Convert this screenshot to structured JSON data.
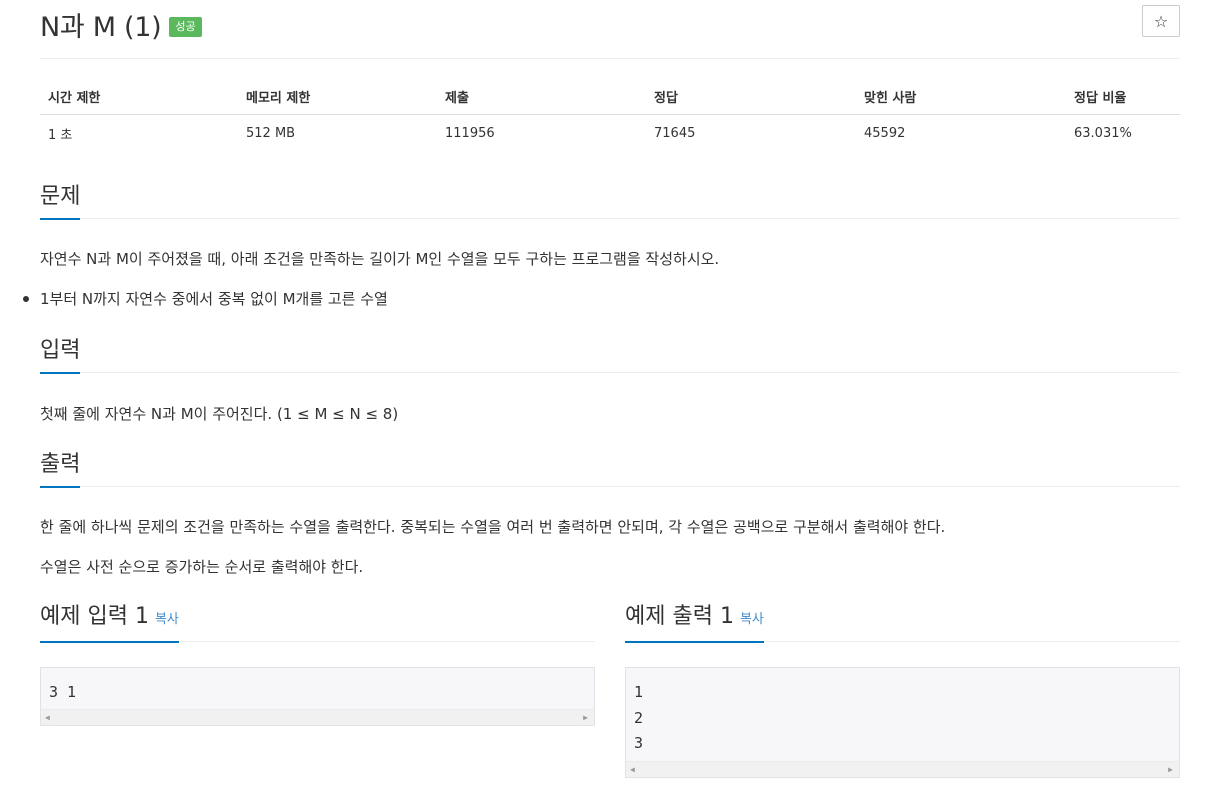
{
  "problem": {
    "title": "N과 M (1)",
    "status_badge": "성공",
    "star_icon": "☆"
  },
  "info_table": {
    "headers": [
      "시간 제한",
      "메모리 제한",
      "제출",
      "정답",
      "맞힌 사람",
      "정답 비율"
    ],
    "values": [
      "1 초",
      "512 MB",
      "111956",
      "71645",
      "45592",
      "63.031%"
    ]
  },
  "description": {
    "heading": "문제",
    "text": "자연수 N과 M이 주어졌을 때, 아래 조건을 만족하는 길이가 M인 수열을 모두 구하는 프로그램을 작성하시오.",
    "conditions": [
      "1부터 N까지 자연수 중에서 중복 없이 M개를 고른 수열"
    ]
  },
  "input": {
    "heading": "입력",
    "text": "첫째 줄에 자연수 N과 M이 주어진다. (1 ≤ M ≤ N ≤ 8)"
  },
  "output": {
    "heading": "출력",
    "text1": "한 줄에 하나씩 문제의 조건을 만족하는 수열을 출력한다. 중복되는 수열을 여러 번 출력하면 안되며, 각 수열은 공백으로 구분해서 출력해야 한다.",
    "text2": "수열은 사전 순으로 증가하는 순서로 출력해야 한다."
  },
  "sample_input": {
    "heading": "예제 입력 1",
    "copy_label": "복사",
    "content": "3 1"
  },
  "sample_output": {
    "heading": "예제 출력 1",
    "copy_label": "복사",
    "content": "1\n2\n3"
  },
  "colors": {
    "accent": "#0076c0",
    "badge": "#5cb85c",
    "link": "#428bca"
  }
}
